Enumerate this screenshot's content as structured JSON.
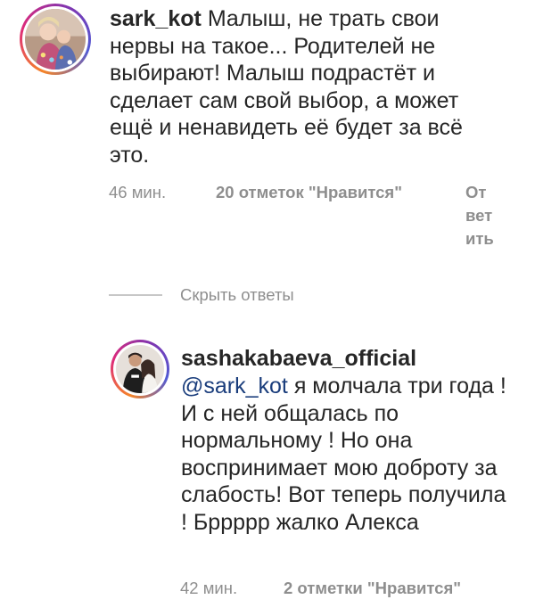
{
  "thread": {
    "comment": {
      "username": "sark_kot",
      "text": "Малыш, не трать свои нервы на такое... Родителей не выбирают!  Малыш подрастёт и сделает сам свой выбор, а может ещё и ненавидеть её будет за всё это.",
      "time": "46 мин.",
      "likes": "20 отметок \"Нравится\"",
      "reply_lines": [
        "От",
        "вет",
        "ить"
      ]
    },
    "hide_replies_label": "Скрыть ответы",
    "reply": {
      "username": "sashakabaeva_official",
      "mention": "@sark_kot",
      "text": "я молчала три года ! И с ней общалась по нормальному ! Но она воспринимает мою доброту за слабость! Вот теперь получила !  Брpppp жалко Алекса",
      "time": "42 мин.",
      "likes": "2 отметки \"Нравится\""
    }
  },
  "colors": {
    "text": "#262626",
    "meta": "#8e8e8e",
    "mention": "#1a3d7c",
    "divider": "#c7c7c7"
  }
}
